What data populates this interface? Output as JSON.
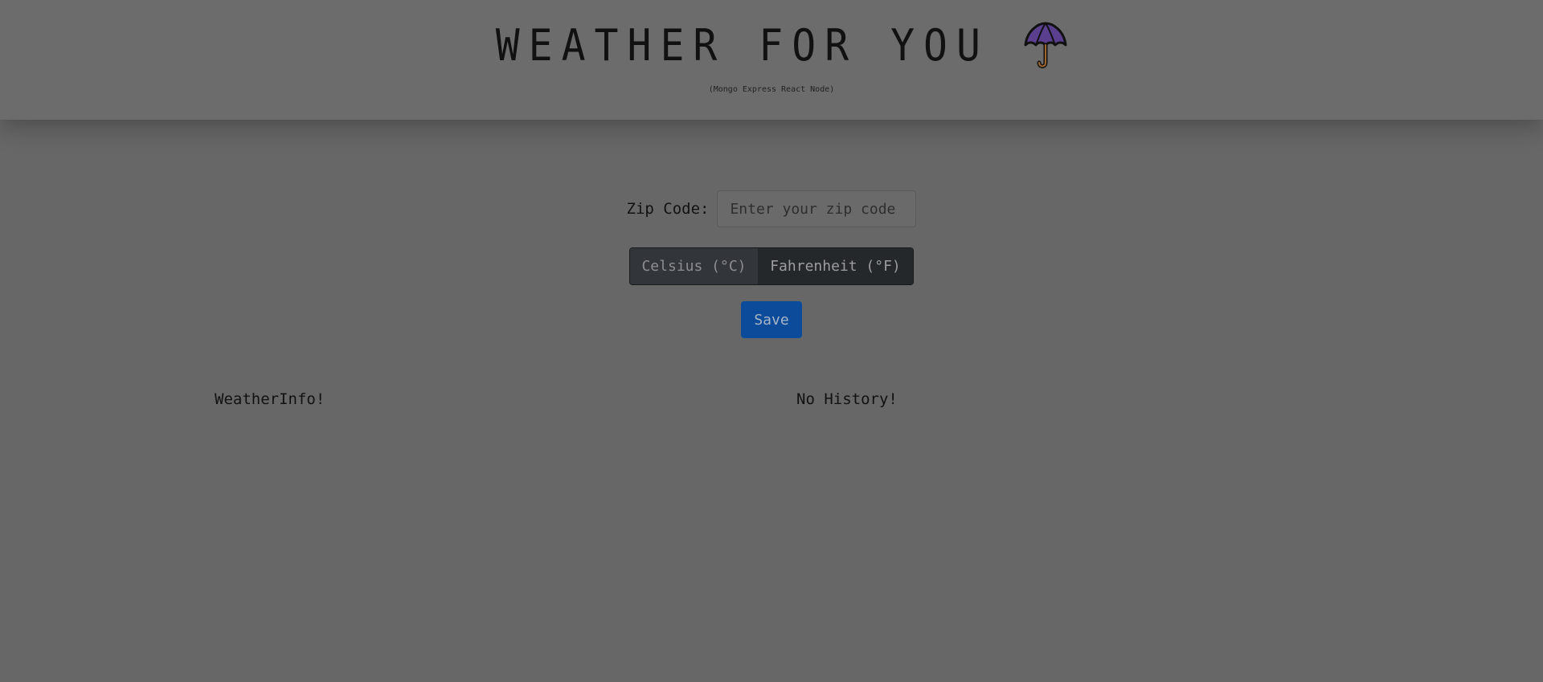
{
  "header": {
    "title": "WEATHER FOR YOU",
    "subtitle": "(Mongo Express React Node)",
    "logo_icon": "umbrella-icon"
  },
  "form": {
    "zip_label": "Zip Code:",
    "zip_placeholder": "Enter your zip code",
    "zip_value": "",
    "units": {
      "celsius_label": "Celsius (°C)",
      "fahrenheit_label": "Fahrenheit (°F)"
    },
    "save_label": "Save"
  },
  "content": {
    "weather_info": "WeatherInfo!",
    "history": "No History!"
  },
  "colors": {
    "background": "#676767",
    "header": "#6c6c6c",
    "save_button": "#0b4b9a",
    "umbrella": "#5b3f8f"
  }
}
